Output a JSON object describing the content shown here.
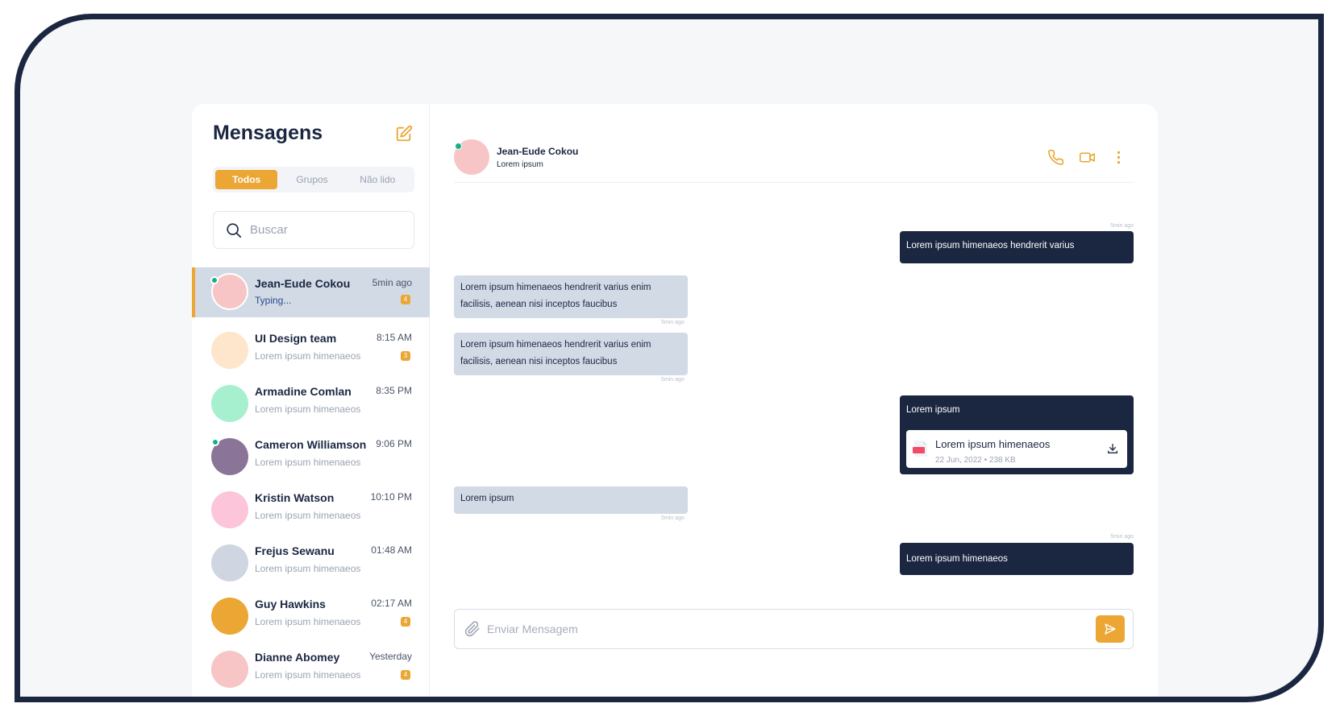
{
  "sidebar": {
    "title": "Mensagens",
    "tabs": [
      {
        "label": "Todos",
        "active": true
      },
      {
        "label": "Grupos",
        "active": false
      },
      {
        "label": "Não lido",
        "active": false
      }
    ],
    "search_placeholder": "Buscar",
    "conversations": [
      {
        "name": "Jean-Eude Cokou",
        "time": "5min ago",
        "preview": "Typing...",
        "badge": "4",
        "online": true,
        "avatar_color": "#f7c5c5",
        "active": true
      },
      {
        "name": "UI Design team",
        "time": "8:15 AM",
        "preview": "Lorem ipsum himenaeos",
        "badge": "3",
        "online": false,
        "avatar_color": "#fde6cc",
        "active": false
      },
      {
        "name": "Armadine Comlan",
        "time": "8:35 PM",
        "preview": "Lorem ipsum himenaeos",
        "badge": "",
        "online": false,
        "avatar_color": "#a6f0cf",
        "active": false
      },
      {
        "name": "Cameron Williamson",
        "time": "9:06 PM",
        "preview": "Lorem ipsum himenaeos",
        "badge": "",
        "online": true,
        "avatar_color": "#8a7598",
        "active": false
      },
      {
        "name": "Kristin Watson",
        "time": "10:10 PM",
        "preview": "Lorem ipsum himenaeos",
        "badge": "",
        "online": false,
        "avatar_color": "#fcc5da",
        "active": false
      },
      {
        "name": "Frejus Sewanu",
        "time": "01:48 AM",
        "preview": "Lorem ipsum himenaeos",
        "badge": "",
        "online": false,
        "avatar_color": "#cfd6e1",
        "active": false
      },
      {
        "name": "Guy Hawkins",
        "time": "02:17 AM",
        "preview": "Lorem ipsum himenaeos",
        "badge": "4",
        "online": false,
        "avatar_color": "#eba633",
        "active": false
      },
      {
        "name": "Dianne Abomey",
        "time": "Yesterday",
        "preview": "Lorem ipsum himenaeos",
        "badge": "4",
        "online": false,
        "avatar_color": "#f7c5c5",
        "active": false
      }
    ]
  },
  "chat": {
    "contact_name": "Jean-Eude Cokou",
    "contact_status": "Lorem ipsum",
    "header_icons": [
      "phone-icon",
      "video-icon",
      "more-vertical-icon"
    ],
    "messages": [
      {
        "dir": "out",
        "text": "Lorem ipsum himenaeos hendrerit varius",
        "time": "5min ago"
      },
      {
        "dir": "in",
        "text": "Lorem ipsum himenaeos hendrerit varius enim facilisis, aenean nisi inceptos faucibus",
        "time": "5min ago"
      },
      {
        "dir": "in",
        "text": "Lorem ipsum himenaeos hendrerit varius enim facilisis, aenean nisi inceptos faucibus",
        "time": "5min ago"
      },
      {
        "dir": "out",
        "text": "Lorem ipsum",
        "file": {
          "name": "Lorem ipsum himenaeos",
          "meta": "22 Jun, 2022 • 238 KB",
          "type_label": "PDF"
        }
      },
      {
        "dir": "in",
        "text": "Lorem ipsum",
        "time": "5min ago"
      },
      {
        "dir": "out",
        "text": "Lorem ipsum himenaeos",
        "time": "5min ago"
      }
    ],
    "composer_placeholder": "Enviar Mensagem"
  },
  "colors": {
    "accent": "#eba633",
    "navy": "#1b2741",
    "incoming_bubble": "#d2dae6",
    "online": "#12b284"
  }
}
